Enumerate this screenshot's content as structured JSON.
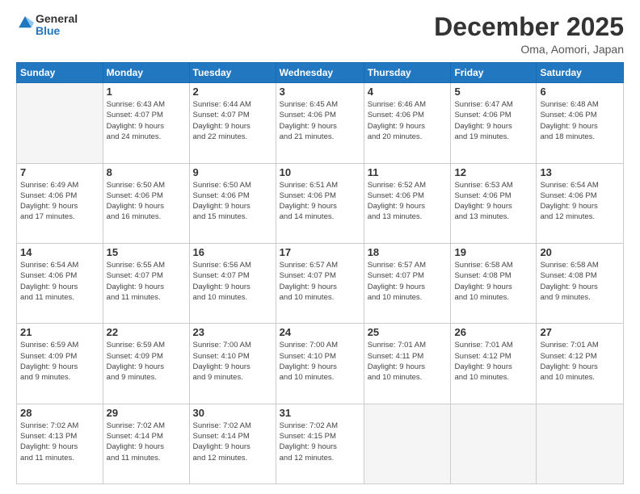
{
  "logo": {
    "line1": "General",
    "line2": "Blue"
  },
  "title": "December 2025",
  "location": "Oma, Aomori, Japan",
  "days_header": [
    "Sunday",
    "Monday",
    "Tuesday",
    "Wednesday",
    "Thursday",
    "Friday",
    "Saturday"
  ],
  "weeks": [
    [
      {
        "day": "",
        "info": ""
      },
      {
        "day": "1",
        "info": "Sunrise: 6:43 AM\nSunset: 4:07 PM\nDaylight: 9 hours\nand 24 minutes."
      },
      {
        "day": "2",
        "info": "Sunrise: 6:44 AM\nSunset: 4:07 PM\nDaylight: 9 hours\nand 22 minutes."
      },
      {
        "day": "3",
        "info": "Sunrise: 6:45 AM\nSunset: 4:06 PM\nDaylight: 9 hours\nand 21 minutes."
      },
      {
        "day": "4",
        "info": "Sunrise: 6:46 AM\nSunset: 4:06 PM\nDaylight: 9 hours\nand 20 minutes."
      },
      {
        "day": "5",
        "info": "Sunrise: 6:47 AM\nSunset: 4:06 PM\nDaylight: 9 hours\nand 19 minutes."
      },
      {
        "day": "6",
        "info": "Sunrise: 6:48 AM\nSunset: 4:06 PM\nDaylight: 9 hours\nand 18 minutes."
      }
    ],
    [
      {
        "day": "7",
        "info": "Sunrise: 6:49 AM\nSunset: 4:06 PM\nDaylight: 9 hours\nand 17 minutes."
      },
      {
        "day": "8",
        "info": "Sunrise: 6:50 AM\nSunset: 4:06 PM\nDaylight: 9 hours\nand 16 minutes."
      },
      {
        "day": "9",
        "info": "Sunrise: 6:50 AM\nSunset: 4:06 PM\nDaylight: 9 hours\nand 15 minutes."
      },
      {
        "day": "10",
        "info": "Sunrise: 6:51 AM\nSunset: 4:06 PM\nDaylight: 9 hours\nand 14 minutes."
      },
      {
        "day": "11",
        "info": "Sunrise: 6:52 AM\nSunset: 4:06 PM\nDaylight: 9 hours\nand 13 minutes."
      },
      {
        "day": "12",
        "info": "Sunrise: 6:53 AM\nSunset: 4:06 PM\nDaylight: 9 hours\nand 13 minutes."
      },
      {
        "day": "13",
        "info": "Sunrise: 6:54 AM\nSunset: 4:06 PM\nDaylight: 9 hours\nand 12 minutes."
      }
    ],
    [
      {
        "day": "14",
        "info": "Sunrise: 6:54 AM\nSunset: 4:06 PM\nDaylight: 9 hours\nand 11 minutes."
      },
      {
        "day": "15",
        "info": "Sunrise: 6:55 AM\nSunset: 4:07 PM\nDaylight: 9 hours\nand 11 minutes."
      },
      {
        "day": "16",
        "info": "Sunrise: 6:56 AM\nSunset: 4:07 PM\nDaylight: 9 hours\nand 10 minutes."
      },
      {
        "day": "17",
        "info": "Sunrise: 6:57 AM\nSunset: 4:07 PM\nDaylight: 9 hours\nand 10 minutes."
      },
      {
        "day": "18",
        "info": "Sunrise: 6:57 AM\nSunset: 4:07 PM\nDaylight: 9 hours\nand 10 minutes."
      },
      {
        "day": "19",
        "info": "Sunrise: 6:58 AM\nSunset: 4:08 PM\nDaylight: 9 hours\nand 10 minutes."
      },
      {
        "day": "20",
        "info": "Sunrise: 6:58 AM\nSunset: 4:08 PM\nDaylight: 9 hours\nand 9 minutes."
      }
    ],
    [
      {
        "day": "21",
        "info": "Sunrise: 6:59 AM\nSunset: 4:09 PM\nDaylight: 9 hours\nand 9 minutes."
      },
      {
        "day": "22",
        "info": "Sunrise: 6:59 AM\nSunset: 4:09 PM\nDaylight: 9 hours\nand 9 minutes."
      },
      {
        "day": "23",
        "info": "Sunrise: 7:00 AM\nSunset: 4:10 PM\nDaylight: 9 hours\nand 9 minutes."
      },
      {
        "day": "24",
        "info": "Sunrise: 7:00 AM\nSunset: 4:10 PM\nDaylight: 9 hours\nand 10 minutes."
      },
      {
        "day": "25",
        "info": "Sunrise: 7:01 AM\nSunset: 4:11 PM\nDaylight: 9 hours\nand 10 minutes."
      },
      {
        "day": "26",
        "info": "Sunrise: 7:01 AM\nSunset: 4:12 PM\nDaylight: 9 hours\nand 10 minutes."
      },
      {
        "day": "27",
        "info": "Sunrise: 7:01 AM\nSunset: 4:12 PM\nDaylight: 9 hours\nand 10 minutes."
      }
    ],
    [
      {
        "day": "28",
        "info": "Sunrise: 7:02 AM\nSunset: 4:13 PM\nDaylight: 9 hours\nand 11 minutes."
      },
      {
        "day": "29",
        "info": "Sunrise: 7:02 AM\nSunset: 4:14 PM\nDaylight: 9 hours\nand 11 minutes."
      },
      {
        "day": "30",
        "info": "Sunrise: 7:02 AM\nSunset: 4:14 PM\nDaylight: 9 hours\nand 12 minutes."
      },
      {
        "day": "31",
        "info": "Sunrise: 7:02 AM\nSunset: 4:15 PM\nDaylight: 9 hours\nand 12 minutes."
      },
      {
        "day": "",
        "info": ""
      },
      {
        "day": "",
        "info": ""
      },
      {
        "day": "",
        "info": ""
      }
    ]
  ]
}
